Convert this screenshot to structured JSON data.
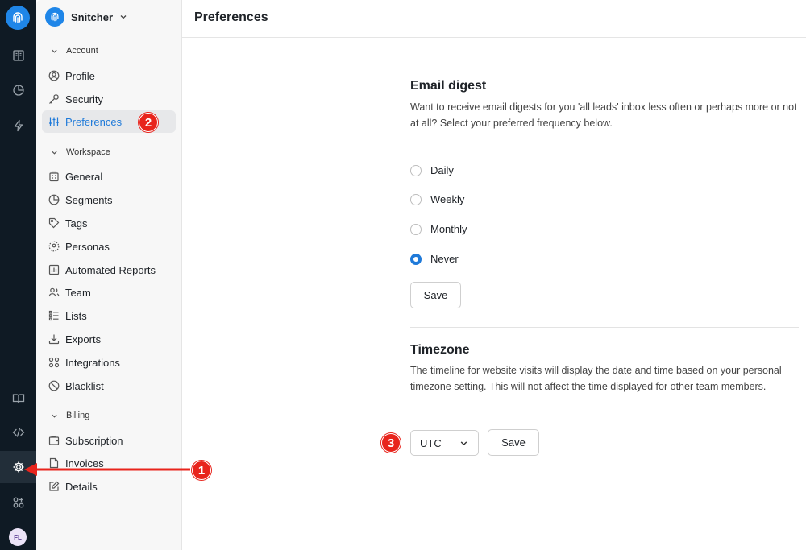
{
  "workspace": {
    "name": "Snitcher"
  },
  "page_title": "Preferences",
  "sidebar": {
    "sections": [
      {
        "label": "Account"
      },
      {
        "label": "Workspace"
      },
      {
        "label": "Billing"
      }
    ],
    "items": [
      {
        "label": "Profile"
      },
      {
        "label": "Security"
      },
      {
        "label": "Preferences"
      },
      {
        "label": "General"
      },
      {
        "label": "Segments"
      },
      {
        "label": "Tags"
      },
      {
        "label": "Personas"
      },
      {
        "label": "Automated Reports"
      },
      {
        "label": "Team"
      },
      {
        "label": "Lists"
      },
      {
        "label": "Exports"
      },
      {
        "label": "Integrations"
      },
      {
        "label": "Blacklist"
      },
      {
        "label": "Subscription"
      },
      {
        "label": "Invoices"
      },
      {
        "label": "Details"
      }
    ]
  },
  "rail": {
    "avatar_initials": "FL"
  },
  "email_digest": {
    "title": "Email digest",
    "description": "Want to receive email digests for you 'all leads' inbox less often or perhaps more or not at all? Select your preferred frequency below.",
    "options": [
      {
        "label": "Daily",
        "selected": false
      },
      {
        "label": "Weekly",
        "selected": false
      },
      {
        "label": "Monthly",
        "selected": false
      },
      {
        "label": "Never",
        "selected": true
      }
    ],
    "save_label": "Save"
  },
  "timezone": {
    "title": "Timezone",
    "description": "The timeline for website visits will display the date and time based on your personal timezone setting. This will not affect the time displayed for other team members.",
    "selected": "UTC",
    "save_label": "Save"
  },
  "annotations": {
    "badge1": "1",
    "badge2": "2",
    "badge3": "3"
  },
  "colors": {
    "accent": "#1f7ad9",
    "rail_bg": "#0f1a24",
    "annotation_red": "#e8241c"
  }
}
